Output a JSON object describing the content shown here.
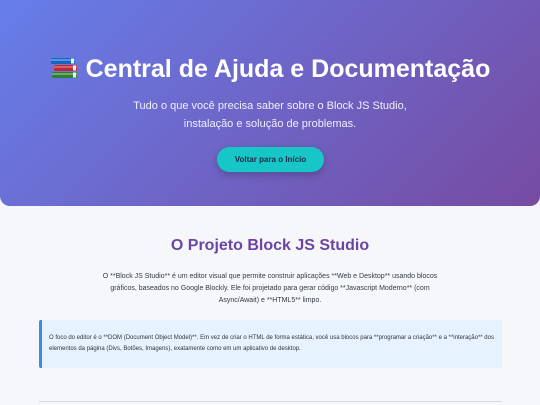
{
  "hero": {
    "emoji_icon": "books-icon",
    "title": "Central de Ajuda e Documentação",
    "subtitle": "Tudo o que você precisa saber sobre o Block JS Studio, instalação e solução de problemas.",
    "button_label": "Voltar para o Início"
  },
  "project": {
    "title": "O Projeto Block JS Studio",
    "intro": "O **Block JS Studio** é um editor visual que permite construir aplicações **Web e Desktop** usando blocos gráficos, baseados no Google Blockly. Ele foi projetado para gerar código **Javascript Moderno** (com Async/Await) e **HTML5** limpo.",
    "note": "O foco do editor é o **DOM (Document Object Model)**. Em vez de criar o HTML de forma estática, você usa blocos para **programar a criação** e a **interação** dos elementos da página (Divs, Botões, Imagens), exatamente como em um aplicativo de desktop."
  },
  "colors": {
    "hero_gradient_start": "#667eea",
    "hero_gradient_end": "#764ba2",
    "button_bg": "#17c6c6",
    "section_title": "#6b44a6",
    "note_bg": "#e6f3fe",
    "note_border": "#3b8ede"
  }
}
